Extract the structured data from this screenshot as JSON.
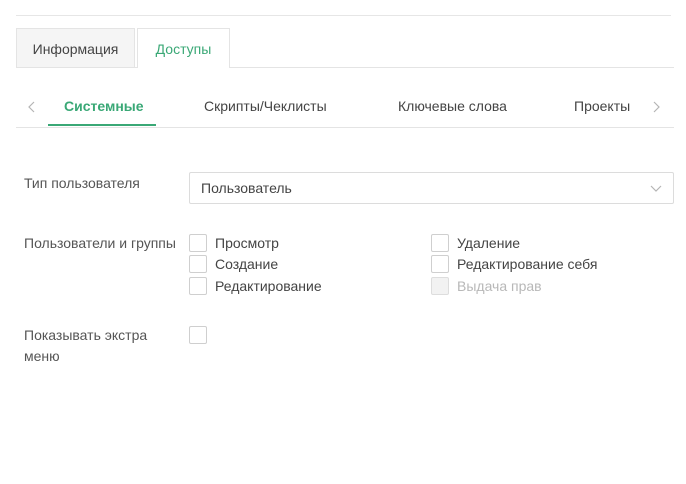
{
  "primary_tabs": [
    {
      "label": "Информация",
      "active": false
    },
    {
      "label": "Доступы",
      "active": true
    }
  ],
  "sub_tabs": [
    {
      "label": "Системные",
      "active": true
    },
    {
      "label": "Скрипты/Чеклисты",
      "active": false
    },
    {
      "label": "Ключевые слова",
      "active": false
    },
    {
      "label": "Проекты",
      "active": false
    }
  ],
  "form": {
    "user_type": {
      "label": "Тип пользователя",
      "value": "Пользователь"
    },
    "users_groups": {
      "label": "Пользователи и группы",
      "options": [
        {
          "label": "Просмотр",
          "checked": false,
          "disabled": false
        },
        {
          "label": "Создание",
          "checked": false,
          "disabled": false
        },
        {
          "label": "Редактирование",
          "checked": false,
          "disabled": false
        },
        {
          "label": "Удаление",
          "checked": false,
          "disabled": false
        },
        {
          "label": "Редактирование себя",
          "checked": false,
          "disabled": false
        },
        {
          "label": "Выдача прав",
          "checked": false,
          "disabled": true
        }
      ]
    },
    "extra_menu": {
      "label_line1": "Показывать экстра",
      "label_line2": "меню",
      "checked": false
    }
  },
  "colors": {
    "accent": "#3aa876",
    "border": "#e4e4e4",
    "disabled_text": "#b8b8b8"
  }
}
